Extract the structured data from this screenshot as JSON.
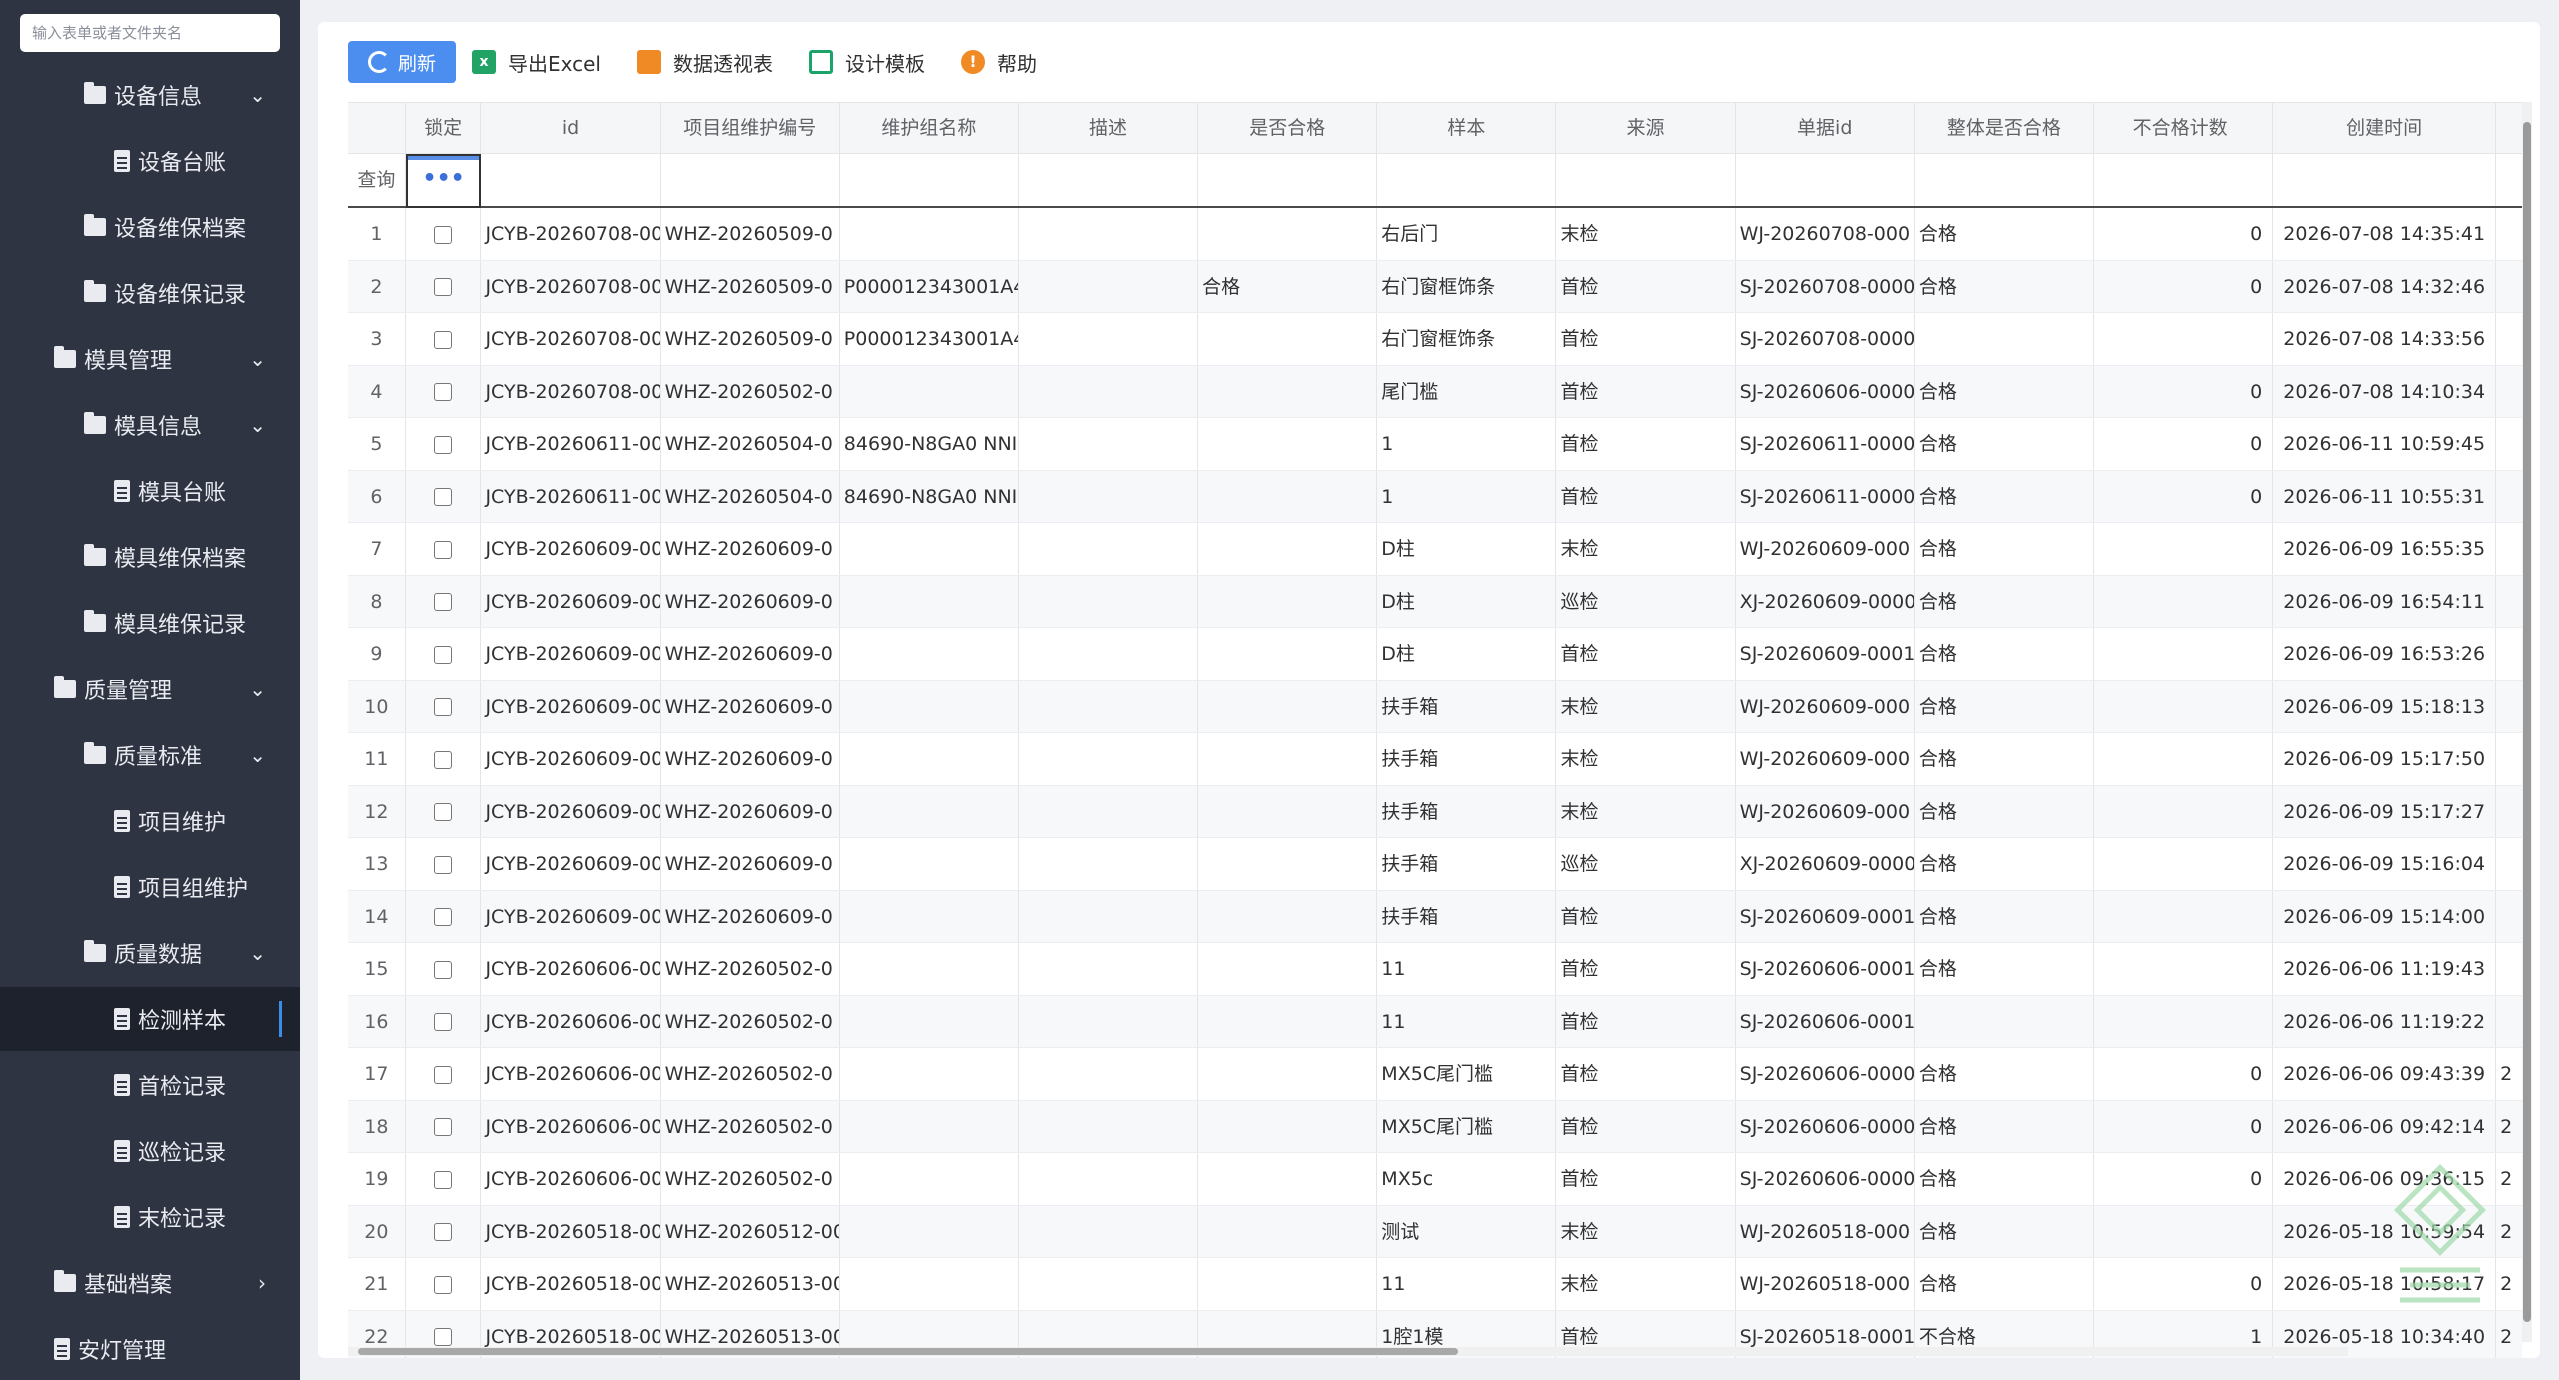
{
  "sidebar": {
    "search_placeholder": "输入表单或者文件夹名",
    "items": [
      {
        "label": "设备信息",
        "icon": "folder-icon",
        "indent": 1,
        "chevron": "⌄"
      },
      {
        "label": "设备台账",
        "icon": "document-icon",
        "indent": 2,
        "chevron": ""
      },
      {
        "label": "设备维保档案",
        "icon": "folder-icon",
        "indent": 1,
        "chevron": ""
      },
      {
        "label": "设备维保记录",
        "icon": "folder-icon",
        "indent": 1,
        "chevron": ""
      },
      {
        "label": "模具管理",
        "icon": "folder-icon",
        "indent": 0,
        "chevron": "⌄"
      },
      {
        "label": "模具信息",
        "icon": "folder-icon",
        "indent": 1,
        "chevron": "⌄"
      },
      {
        "label": "模具台账",
        "icon": "document-icon",
        "indent": 2,
        "chevron": ""
      },
      {
        "label": "模具维保档案",
        "icon": "folder-icon",
        "indent": 1,
        "chevron": ""
      },
      {
        "label": "模具维保记录",
        "icon": "folder-icon",
        "indent": 1,
        "chevron": ""
      },
      {
        "label": "质量管理",
        "icon": "folder-icon",
        "indent": 0,
        "chevron": "⌄"
      },
      {
        "label": "质量标准",
        "icon": "folder-icon",
        "indent": 1,
        "chevron": "⌄"
      },
      {
        "label": "项目维护",
        "icon": "document-icon",
        "indent": 2,
        "chevron": ""
      },
      {
        "label": "项目组维护",
        "icon": "document-icon",
        "indent": 2,
        "chevron": ""
      },
      {
        "label": "质量数据",
        "icon": "folder-icon",
        "indent": 1,
        "chevron": "⌄"
      },
      {
        "label": "检测样本",
        "icon": "document-icon",
        "indent": 2,
        "chevron": "",
        "active": true
      },
      {
        "label": "首检记录",
        "icon": "document-icon",
        "indent": 2,
        "chevron": ""
      },
      {
        "label": "巡检记录",
        "icon": "document-icon",
        "indent": 2,
        "chevron": ""
      },
      {
        "label": "末检记录",
        "icon": "document-icon",
        "indent": 2,
        "chevron": ""
      },
      {
        "label": "基础档案",
        "icon": "folder-icon",
        "indent": 0,
        "chevron": "›"
      },
      {
        "label": "安灯管理",
        "icon": "document-icon",
        "indent": 0,
        "chevron": ""
      }
    ]
  },
  "toolbar": {
    "refresh": "刷新",
    "export_excel": "导出Excel",
    "pivot": "数据透视表",
    "design": "设计模板",
    "help": "帮助"
  },
  "grid": {
    "columns": [
      "锁定",
      "id",
      "项目组维护编号",
      "维护组名称",
      "描述",
      "是否合格",
      "样本",
      "来源",
      "单据id",
      "整体是否合格",
      "不合格计数",
      "创建时间"
    ],
    "query_label": "查询",
    "query_lock_value": "•••",
    "rows": [
      {
        "n": "1",
        "id": "JCYB-20260708-00",
        "proj": "WHZ-20260509-0",
        "name": "",
        "desc": "",
        "pass": "",
        "sample": "右后门",
        "src": "末检",
        "doc": "WJ-20260708-000",
        "whole": "合格",
        "fail": "0",
        "time": "2026-07-08 14:35:41",
        "extra": ""
      },
      {
        "n": "2",
        "id": "JCYB-20260708-00",
        "proj": "WHZ-20260509-0",
        "name": "P000012343001A4",
        "desc": "",
        "pass": "合格",
        "sample": "右门窗框饰条",
        "src": "首检",
        "doc": "SJ-20260708-0000",
        "whole": "合格",
        "fail": "0",
        "time": "2026-07-08 14:32:46",
        "extra": ""
      },
      {
        "n": "3",
        "id": "JCYB-20260708-00",
        "proj": "WHZ-20260509-0",
        "name": "P000012343001A4",
        "desc": "",
        "pass": "",
        "sample": "右门窗框饰条",
        "src": "首检",
        "doc": "SJ-20260708-0000",
        "whole": "",
        "fail": "",
        "time": "2026-07-08 14:33:56",
        "extra": ""
      },
      {
        "n": "4",
        "id": "JCYB-20260708-00",
        "proj": "WHZ-20260502-0",
        "name": "",
        "desc": "",
        "pass": "",
        "sample": "尾门槛",
        "src": "首检",
        "doc": "SJ-20260606-0000",
        "whole": "合格",
        "fail": "0",
        "time": "2026-07-08 14:10:34",
        "extra": ""
      },
      {
        "n": "5",
        "id": "JCYB-20260611-00",
        "proj": "WHZ-20260504-0",
        "name": "84690-N8GA0 NNI",
        "desc": "",
        "pass": "",
        "sample": "1",
        "src": "首检",
        "doc": "SJ-20260611-0000",
        "whole": "合格",
        "fail": "0",
        "time": "2026-06-11 10:59:45",
        "extra": ""
      },
      {
        "n": "6",
        "id": "JCYB-20260611-00",
        "proj": "WHZ-20260504-0",
        "name": "84690-N8GA0 NNI",
        "desc": "",
        "pass": "",
        "sample": "1",
        "src": "首检",
        "doc": "SJ-20260611-0000",
        "whole": "合格",
        "fail": "0",
        "time": "2026-06-11 10:55:31",
        "extra": ""
      },
      {
        "n": "7",
        "id": "JCYB-20260609-00",
        "proj": "WHZ-20260609-0",
        "name": "",
        "desc": "",
        "pass": "",
        "sample": "D柱",
        "src": "末检",
        "doc": "WJ-20260609-000",
        "whole": "合格",
        "fail": "",
        "time": "2026-06-09 16:55:35",
        "extra": ""
      },
      {
        "n": "8",
        "id": "JCYB-20260609-00",
        "proj": "WHZ-20260609-0",
        "name": "",
        "desc": "",
        "pass": "",
        "sample": "D柱",
        "src": "巡检",
        "doc": "XJ-20260609-0000",
        "whole": "合格",
        "fail": "",
        "time": "2026-06-09 16:54:11",
        "extra": ""
      },
      {
        "n": "9",
        "id": "JCYB-20260609-00",
        "proj": "WHZ-20260609-0",
        "name": "",
        "desc": "",
        "pass": "",
        "sample": "D柱",
        "src": "首检",
        "doc": "SJ-20260609-0001",
        "whole": "合格",
        "fail": "",
        "time": "2026-06-09 16:53:26",
        "extra": ""
      },
      {
        "n": "10",
        "id": "JCYB-20260609-00",
        "proj": "WHZ-20260609-0",
        "name": "",
        "desc": "",
        "pass": "",
        "sample": "扶手箱",
        "src": "末检",
        "doc": "WJ-20260609-000",
        "whole": "合格",
        "fail": "",
        "time": "2026-06-09 15:18:13",
        "extra": ""
      },
      {
        "n": "11",
        "id": "JCYB-20260609-00",
        "proj": "WHZ-20260609-0",
        "name": "",
        "desc": "",
        "pass": "",
        "sample": "扶手箱",
        "src": "末检",
        "doc": "WJ-20260609-000",
        "whole": "合格",
        "fail": "",
        "time": "2026-06-09 15:17:50",
        "extra": ""
      },
      {
        "n": "12",
        "id": "JCYB-20260609-00",
        "proj": "WHZ-20260609-0",
        "name": "",
        "desc": "",
        "pass": "",
        "sample": "扶手箱",
        "src": "末检",
        "doc": "WJ-20260609-000",
        "whole": "合格",
        "fail": "",
        "time": "2026-06-09 15:17:27",
        "extra": ""
      },
      {
        "n": "13",
        "id": "JCYB-20260609-00",
        "proj": "WHZ-20260609-0",
        "name": "",
        "desc": "",
        "pass": "",
        "sample": "扶手箱",
        "src": "巡检",
        "doc": "XJ-20260609-0000",
        "whole": "合格",
        "fail": "",
        "time": "2026-06-09 15:16:04",
        "extra": ""
      },
      {
        "n": "14",
        "id": "JCYB-20260609-00",
        "proj": "WHZ-20260609-0",
        "name": "",
        "desc": "",
        "pass": "",
        "sample": "扶手箱",
        "src": "首检",
        "doc": "SJ-20260609-0001",
        "whole": "合格",
        "fail": "",
        "time": "2026-06-09 15:14:00",
        "extra": ""
      },
      {
        "n": "15",
        "id": "JCYB-20260606-00",
        "proj": "WHZ-20260502-0",
        "name": "",
        "desc": "",
        "pass": "",
        "sample": "11",
        "src": "首检",
        "doc": "SJ-20260606-0001",
        "whole": "合格",
        "fail": "",
        "time": "2026-06-06 11:19:43",
        "extra": ""
      },
      {
        "n": "16",
        "id": "JCYB-20260606-00",
        "proj": "WHZ-20260502-0",
        "name": "",
        "desc": "",
        "pass": "",
        "sample": "11",
        "src": "首检",
        "doc": "SJ-20260606-0001",
        "whole": "",
        "fail": "",
        "time": "2026-06-06 11:19:22",
        "extra": ""
      },
      {
        "n": "17",
        "id": "JCYB-20260606-00",
        "proj": "WHZ-20260502-0",
        "name": "",
        "desc": "",
        "pass": "",
        "sample": "MX5C尾门槛",
        "src": "首检",
        "doc": "SJ-20260606-0000",
        "whole": "合格",
        "fail": "0",
        "time": "2026-06-06 09:43:39",
        "extra": "2"
      },
      {
        "n": "18",
        "id": "JCYB-20260606-00",
        "proj": "WHZ-20260502-0",
        "name": "",
        "desc": "",
        "pass": "",
        "sample": "MX5C尾门槛",
        "src": "首检",
        "doc": "SJ-20260606-0000",
        "whole": "合格",
        "fail": "0",
        "time": "2026-06-06 09:42:14",
        "extra": "2"
      },
      {
        "n": "19",
        "id": "JCYB-20260606-00",
        "proj": "WHZ-20260502-0",
        "name": "",
        "desc": "",
        "pass": "",
        "sample": "MX5c",
        "src": "首检",
        "doc": "SJ-20260606-0000",
        "whole": "合格",
        "fail": "0",
        "time": "2026-06-06 09:36:15",
        "extra": "2"
      },
      {
        "n": "20",
        "id": "JCYB-20260518-00",
        "proj": "WHZ-20260512-00",
        "name": "",
        "desc": "",
        "pass": "",
        "sample": "测试",
        "src": "末检",
        "doc": "WJ-20260518-000",
        "whole": "合格",
        "fail": "",
        "time": "2026-05-18 10:59:54",
        "extra": "2"
      },
      {
        "n": "21",
        "id": "JCYB-20260518-00",
        "proj": "WHZ-20260513-00",
        "name": "",
        "desc": "",
        "pass": "",
        "sample": "11",
        "src": "末检",
        "doc": "WJ-20260518-000",
        "whole": "合格",
        "fail": "0",
        "time": "2026-05-18 10:58:17",
        "extra": "2"
      },
      {
        "n": "22",
        "id": "JCYB-20260518-00",
        "proj": "WHZ-20260513-00",
        "name": "",
        "desc": "",
        "pass": "",
        "sample": "1腔1模",
        "src": "首检",
        "doc": "SJ-20260518-0001",
        "whole": "不合格",
        "fail": "1",
        "time": "2026-05-18 10:34:40",
        "extra": "2"
      }
    ]
  },
  "colors": {
    "sidebar_bg": "#2f3442",
    "active_bg": "#1e222c",
    "accent": "#4c8ef0"
  }
}
